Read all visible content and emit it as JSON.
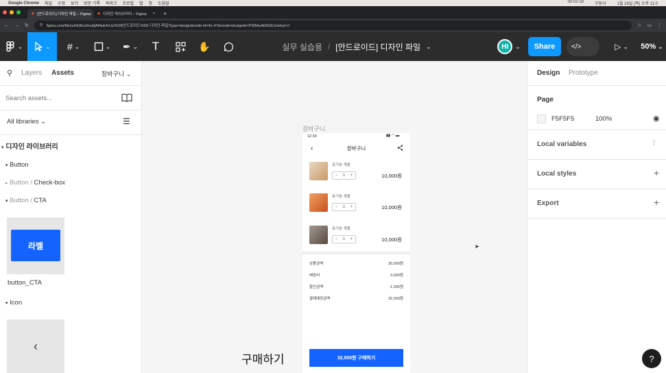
{
  "mac": {
    "app": "Google Chrome",
    "menus": [
      "파일",
      "수정",
      "보기",
      "방문 기록",
      "북마크",
      "프로필",
      "탭",
      "창",
      "도움말"
    ],
    "timer": "00:02:18",
    "clock": "1월 18일 (목) 오후 11:0",
    "user_badge": "구동사"
  },
  "browser": {
    "tabs": [
      {
        "label": "[안드로이드] 디자인 파일 – Figma",
        "close": "×"
      },
      {
        "label": "디자인 라이브러리 – Figma",
        "close": "×"
      }
    ],
    "new_tab": "+",
    "url": "figma.com/file/usNr8hu3mu6jAIAuk4rLtz/%5B안드로이드%5D-디자인-파일?type=design&node-id=41-47&mode=design&t=PD8AoAkNGEUuHoyf-0"
  },
  "toolbar": {
    "project": "실무 실습용",
    "separator": "/",
    "file": "[안드로이드] 디자인 파일",
    "avatar": "HI",
    "share": "Share",
    "zoom": "50%"
  },
  "left": {
    "tab_layers": "Layers",
    "tab_assets": "Assets",
    "page": "장바구니",
    "search_placeholder": "Search assets...",
    "libraries": "All libraries",
    "library_name": "디자인 라이브러리",
    "tree": {
      "button": "Button",
      "checkbox_prefix": "Button / ",
      "checkbox": "Check-box",
      "cta_prefix": "Button / ",
      "cta": "CTA",
      "icon": "Icon"
    },
    "cta_preview_label": "라벨",
    "cta_component": "button_CTA",
    "icon_preview_glyph": "‹"
  },
  "canvas": {
    "frame_name": "장바구니",
    "floating_text": "구매하기",
    "phone": {
      "time": "12:30",
      "title": "장바구니",
      "items": [
        {
          "name": "유기농 개껌",
          "qty": "1",
          "price": "10,000원",
          "color": "#c89868"
        },
        {
          "name": "유기농 개껌",
          "qty": "1",
          "price": "10,000원",
          "color": "#d8642a"
        },
        {
          "name": "유기농 개껌",
          "qty": "1",
          "price": "10,000원",
          "color": "#8a7a70"
        }
      ],
      "summary": [
        {
          "label": "상품금액",
          "value": "30,000원"
        },
        {
          "label": "배송비",
          "value": "3,000원"
        },
        {
          "label": "할인금액",
          "value": "-1,000원"
        },
        {
          "label": "결제예정금액",
          "value": "32,000원"
        }
      ],
      "cta": "32,000원 구매하기"
    }
  },
  "right": {
    "tab_design": "Design",
    "tab_prototype": "Prototype",
    "page_heading": "Page",
    "page_color": "F5F5F5",
    "page_opacity": "100%",
    "local_variables": "Local variables",
    "local_styles": "Local styles",
    "export": "Export",
    "help": "?"
  },
  "colors": {
    "accent": "#0d99ff",
    "cta_blue": "#1463ff",
    "avatar": "#12b3a8",
    "toolbar": "#2c2c2c"
  }
}
